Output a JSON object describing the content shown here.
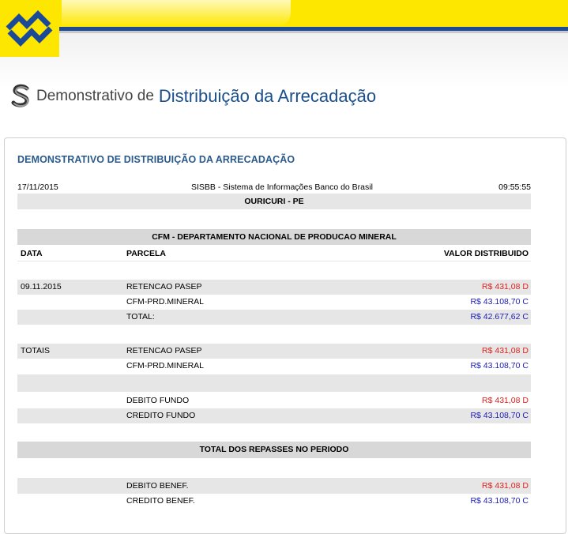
{
  "header": {
    "logo_name": "banco-do-brasil-logo",
    "title_light": "Demonstrativo de",
    "title_strong": "Distribuição da Arrecadação"
  },
  "panel": {
    "title": "DEMONSTRATIVO DE DISTRIBUIÇÃO DA ARRECADAÇÃO",
    "date": "17/11/2015",
    "system": "SISBB - Sistema de Informações Banco do Brasil",
    "time": "09:55:55",
    "municipality": "OURICURI - PE",
    "fund_name": "CFM - DEPARTAMENTO NACIONAL DE PRODUCAO MINERAL",
    "columns": {
      "data": "DATA",
      "parcela": "PARCELA",
      "valor": "VALOR DISTRIBUIDO"
    },
    "entries": [
      {
        "data": "09.11.2015",
        "parcela": "RETENCAO PASEP",
        "valor": "R$ 431,08 D"
      },
      {
        "data": "",
        "parcela": "CFM-PRD.MINERAL",
        "valor": "R$ 43.108,70 C"
      },
      {
        "data": "",
        "parcela": "TOTAL:",
        "valor": "R$ 42.677,62 C"
      }
    ],
    "totals": [
      {
        "data": "TOTAIS",
        "parcela": "RETENCAO PASEP",
        "valor": "R$ 431,08 D"
      },
      {
        "data": "",
        "parcela": "CFM-PRD.MINERAL",
        "valor": "R$ 43.108,70 C"
      }
    ],
    "fund": [
      {
        "parcela": "DEBITO FUNDO",
        "valor": "R$ 431,08 D"
      },
      {
        "parcela": "CREDITO FUNDO",
        "valor": "R$ 43.108,70 C"
      }
    ],
    "period_title": "TOTAL DOS REPASSES NO PERIODO",
    "benef": [
      {
        "parcela": "DEBITO BENEF.",
        "valor": "R$ 431,08 D"
      },
      {
        "parcela": "CREDITO BENEF.",
        "valor": "R$ 43.108,70 C"
      }
    ]
  },
  "colors": {
    "brand_yellow": "#fde700",
    "brand_blue": "#1b4a98",
    "debit_red": "#e0201b",
    "credit_blue": "#1a1ab3"
  }
}
